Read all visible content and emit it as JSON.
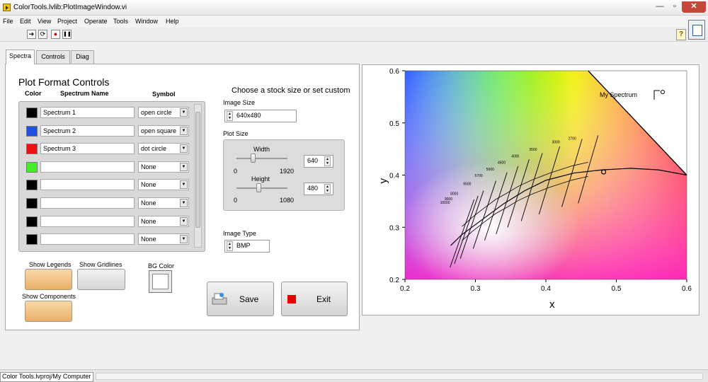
{
  "window": {
    "title": "ColorTools.lvlib:PlotImageWindow.vi",
    "min": "—",
    "max": "▫",
    "close": "✕"
  },
  "menu": [
    "File",
    "Edit",
    "View",
    "Project",
    "Operate",
    "Tools",
    "Window",
    "Help"
  ],
  "toolbar": {
    "run": "➔",
    "run_continuous": "⟳",
    "abort": "●",
    "pause": "❚❚",
    "help": "?"
  },
  "tabs": [
    "Spectra",
    "Controls",
    "Diag"
  ],
  "format": {
    "heading": "Plot Format Controls",
    "col_color": "Color",
    "col_name": "Spectrum Name",
    "col_symbol": "Symbol",
    "rows": [
      {
        "color": "#000000",
        "name": "Spectrum 1",
        "symbol": "open circle"
      },
      {
        "color": "#1f50e0",
        "name": "Spectrum 2",
        "symbol": "open square"
      },
      {
        "color": "#ee1111",
        "name": "Spectrum 3",
        "symbol": "dot circle"
      },
      {
        "color": "#44ee22",
        "name": "",
        "symbol": "None"
      },
      {
        "color": "#000000",
        "name": "",
        "symbol": "None"
      },
      {
        "color": "#000000",
        "name": "",
        "symbol": "None"
      },
      {
        "color": "#000000",
        "name": "",
        "symbol": "None"
      },
      {
        "color": "#000000",
        "name": "",
        "symbol": "None"
      }
    ],
    "show_legends": "Show Legends",
    "show_gridlines": "Show Gridlines",
    "show_components": "Show Components",
    "bg_color": "BG Color"
  },
  "size": {
    "stock_heading": "Choose a stock size or set custom",
    "image_size_label": "Image Size",
    "image_size": "640x480",
    "plot_size_label": "Plot Size",
    "width_label": "Width",
    "width_min": "0",
    "width_max": "1920",
    "width_value": "640",
    "width_level": 0.333,
    "height_label": "Height",
    "height_min": "0",
    "height_max": "1080",
    "height_value": "480",
    "height_level": 0.444,
    "image_type_label": "Image Type",
    "image_type": "BMP"
  },
  "actions": {
    "save": "Save",
    "exit": "Exit"
  },
  "plot": {
    "legend_label": "My Spectrum",
    "xlabel": "x",
    "ylabel": "y",
    "xticks": [
      "0.2",
      "0.3",
      "0.4",
      "0.5",
      "0.6"
    ],
    "yticks": [
      "0.6",
      "0.5",
      "0.4",
      "0.3",
      "0.2"
    ],
    "cct_labels": [
      "2700",
      "3000",
      "3500",
      "4000",
      "4500",
      "5000",
      "5700",
      "6500",
      "8000",
      "9000",
      "10000"
    ]
  },
  "chart_data": {
    "type": "scatter",
    "xlim": [
      0.2,
      0.6
    ],
    "ylim": [
      0.2,
      0.6
    ],
    "xlabel": "x",
    "ylabel": "y",
    "grid": false,
    "legend": "top-right",
    "series": [
      {
        "name": "My Spectrum",
        "points": [
          [
            0.482,
            0.406
          ]
        ]
      }
    ],
    "planckian_locus": [
      [
        0.265,
        0.265
      ],
      [
        0.28,
        0.285
      ],
      [
        0.3,
        0.305
      ],
      [
        0.32,
        0.325
      ],
      [
        0.34,
        0.345
      ],
      [
        0.37,
        0.37
      ],
      [
        0.4,
        0.39
      ],
      [
        0.44,
        0.404
      ],
      [
        0.48,
        0.41
      ],
      [
        0.52,
        0.413
      ],
      [
        0.56,
        0.41
      ],
      [
        0.6,
        0.4
      ]
    ],
    "cct_points": [
      {
        "label": "2700",
        "x": 0.46,
        "y": 0.411
      },
      {
        "label": "3000",
        "x": 0.437,
        "y": 0.404
      },
      {
        "label": "3500",
        "x": 0.405,
        "y": 0.39
      },
      {
        "label": "4000",
        "x": 0.38,
        "y": 0.377
      },
      {
        "label": "4500",
        "x": 0.361,
        "y": 0.365
      },
      {
        "label": "5000",
        "x": 0.345,
        "y": 0.352
      },
      {
        "label": "5700",
        "x": 0.329,
        "y": 0.34
      },
      {
        "label": "6500",
        "x": 0.313,
        "y": 0.324
      },
      {
        "label": "8000",
        "x": 0.295,
        "y": 0.305
      },
      {
        "label": "9000",
        "x": 0.287,
        "y": 0.295
      },
      {
        "label": "10000",
        "x": 0.281,
        "y": 0.288
      }
    ]
  },
  "status": {
    "path": "Color Tools.lvproj/My Computer"
  }
}
